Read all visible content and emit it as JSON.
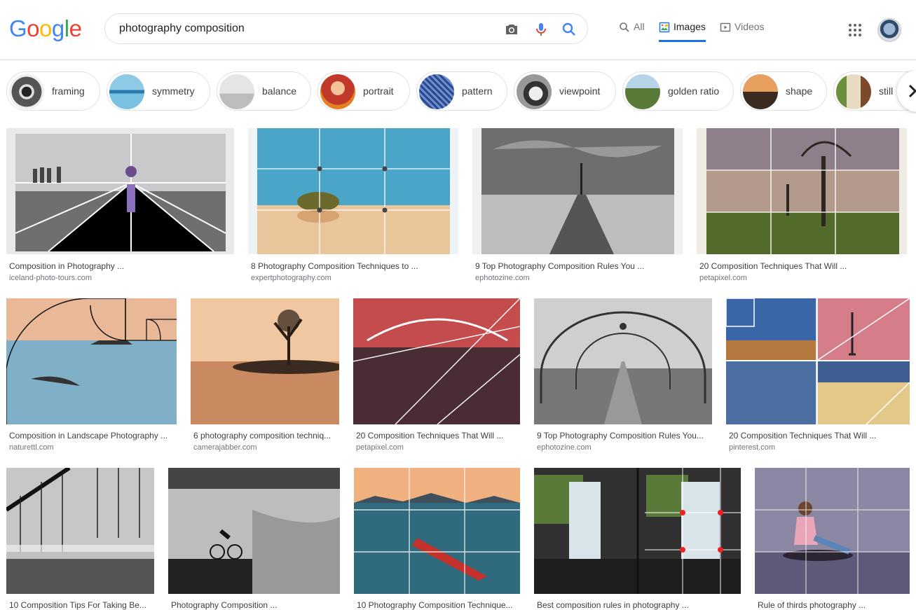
{
  "header": {
    "logo": [
      "G",
      "o",
      "o",
      "g",
      "l",
      "e"
    ],
    "logo_colors": [
      "#4285f4",
      "#ea4335",
      "#fbbc05",
      "#4285f4",
      "#34a853",
      "#ea4335"
    ],
    "search_query": "photography composition",
    "tabs": [
      {
        "label": "All",
        "icon": "search-icon"
      },
      {
        "label": "Images",
        "icon": "image-icon"
      },
      {
        "label": "Videos",
        "icon": "video-icon"
      }
    ],
    "active_tab": "Images"
  },
  "chips": [
    {
      "label": "framing"
    },
    {
      "label": "symmetry"
    },
    {
      "label": "balance"
    },
    {
      "label": "portrait"
    },
    {
      "label": "pattern"
    },
    {
      "label": "viewpoint"
    },
    {
      "label": "golden ratio"
    },
    {
      "label": "shape"
    },
    {
      "label": "still"
    }
  ],
  "results": [
    {
      "title": "Composition in Photography ...",
      "source": "iceland-photo-tours.com"
    },
    {
      "title": "8 Photography Composition Techniques to ...",
      "source": "expertphotography.com"
    },
    {
      "title": "9 Top Photography Composition Rules You ...",
      "source": "ephotozine.com"
    },
    {
      "title": "20 Composition Techniques That Will ...",
      "source": "petapixel.com"
    },
    {
      "title": "Composition in Landscape Photography ...",
      "source": "naturettl.com"
    },
    {
      "title": "6 photography composition techniq...",
      "source": "camerajabber.com"
    },
    {
      "title": "20 Composition Techniques That Will ...",
      "source": "petapixel.com"
    },
    {
      "title": "9 Top Photography Composition Rules You...",
      "source": "ephotozine.com"
    },
    {
      "title": "20 Composition Techniques That Will ...",
      "source": "pinterest.com"
    },
    {
      "title": "10 Composition Tips For Taking Be...",
      "source": ""
    },
    {
      "title": "Photography Composition ...",
      "source": ""
    },
    {
      "title": "10 Photography Composition Technique...",
      "source": ""
    },
    {
      "title": "Best composition rules in photography ...",
      "source": ""
    },
    {
      "title": "Rule of thirds photography ...",
      "source": ""
    }
  ]
}
